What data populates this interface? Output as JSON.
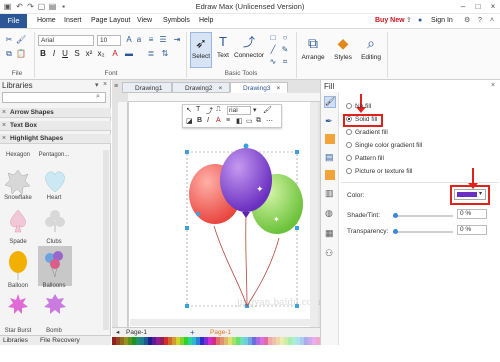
{
  "window": {
    "title": "Edraw Max (Unlicensed Version)"
  },
  "menu": {
    "file": "File",
    "items": [
      "Home",
      "Insert",
      "Page Layout",
      "View",
      "Symbols",
      "Help"
    ],
    "buy_now": "Buy New",
    "sign_in": "Sign In"
  },
  "ribbon": {
    "font_name": "Arial",
    "font_size": "10",
    "select_label": "Select",
    "text_label": "Text",
    "connector_label": "Connector",
    "arrange_label": "Arrange",
    "styles_label": "Styles",
    "editing_label": "Editing",
    "groups": {
      "file": "File",
      "font": "Font",
      "basic_tools": "Basic Tools"
    }
  },
  "libraries": {
    "title": "Libraries",
    "sections": [
      "Arrow Shapes",
      "Text Box",
      "Highlight Shapes"
    ],
    "shape_labels": [
      "Hexagon",
      "Pentagon...",
      "Snowflake",
      "Heart",
      "Spade",
      "Clubs",
      "Balloon",
      "Balloons",
      "Star Burst",
      "Bomb"
    ],
    "bottom_tabs": [
      "Libraries",
      "File Recovery"
    ]
  },
  "tabs": [
    "Drawing1",
    "Drawing2",
    "Drawing3"
  ],
  "float_toolbar": {
    "font": "rial"
  },
  "fill": {
    "title": "Fill",
    "options": [
      "No fill",
      "Solid fill",
      "Gradient fill",
      "Single color gradient fill",
      "Pattern fill",
      "Picture or texture fill"
    ],
    "selected": "Solid fill",
    "color_label": "Color:",
    "color_value": "#6a2fc0",
    "shade_label": "Shade/Tint:",
    "shade_value": "0 %",
    "transparency_label": "Transparency:",
    "transparency_value": "0 %"
  },
  "pagebar": {
    "page_tab": "Page-1",
    "active_page": "Page-1"
  },
  "colors": {
    "accent": "#2b5797",
    "highlight": "#e0221c"
  },
  "watermark": "jingyan.baidu.com"
}
